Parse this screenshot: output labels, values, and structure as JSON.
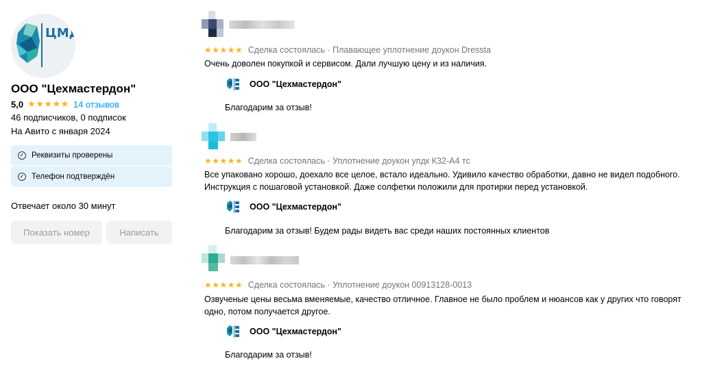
{
  "seller": {
    "name": "ООО \"Цехмастердон\"",
    "rating": "5,0",
    "stars": "★★★★★",
    "reviews_link": "14 отзывов",
    "subscribers": "46 подписчиков, 0 подписок",
    "since": "На Авито с января 2024",
    "badges": [
      {
        "label": "Реквизиты проверены",
        "icon": "check-circle-icon"
      },
      {
        "label": "Телефон подтверждён",
        "icon": "check-circle-icon"
      }
    ],
    "reply_time": "Отвечает около 30 минут",
    "show_phone": "Показать номер",
    "write": "Написать",
    "logo_letters": "ЦМД"
  },
  "reviews": [
    {
      "stars": "★★★★★",
      "meta": "Сделка состоялась · Плавающее уплотнение доукон Dressta",
      "text": "Очень доволен покупкой и сервисом. Дали лучшую цену и из наличия.",
      "reply_name": "ООО \"Цехмастердон\"",
      "reply_text": "Благодарим за отзыв!"
    },
    {
      "stars": "★★★★★",
      "meta": "Сделка состоялась · Уплотнение доукон упдк К32-А4 тс",
      "text": "Все упаковано хорошо, доехало все целое, встало идеально. Удивило качество обработки, давно не видел подобного. Инструкция с пошаговой установкой. Даже солфетки положили для протирки перед установкой.",
      "reply_name": "ООО \"Цехмастердон\"",
      "reply_text": "Благодарим за отзыв! Будем рады видеть вас среди наших постоянных клиентов"
    },
    {
      "stars": "★★★★★",
      "meta": "Сделка состоялась · Уплотнение доукон 00913128-0013",
      "text": "Озвученые цены весьма вменяемые, качество отличное. Главное не было проблем и нюансов как у других что говорят одно, потом получается другое.",
      "reply_name": "ООО \"Цехмастердон\"",
      "reply_text": "Благодарим за отзыв!"
    }
  ],
  "colors": {
    "star": "#ffb021",
    "link": "#0099f7",
    "badge_bg": "#e4f3fb",
    "button_bg": "#f2f2f2"
  }
}
